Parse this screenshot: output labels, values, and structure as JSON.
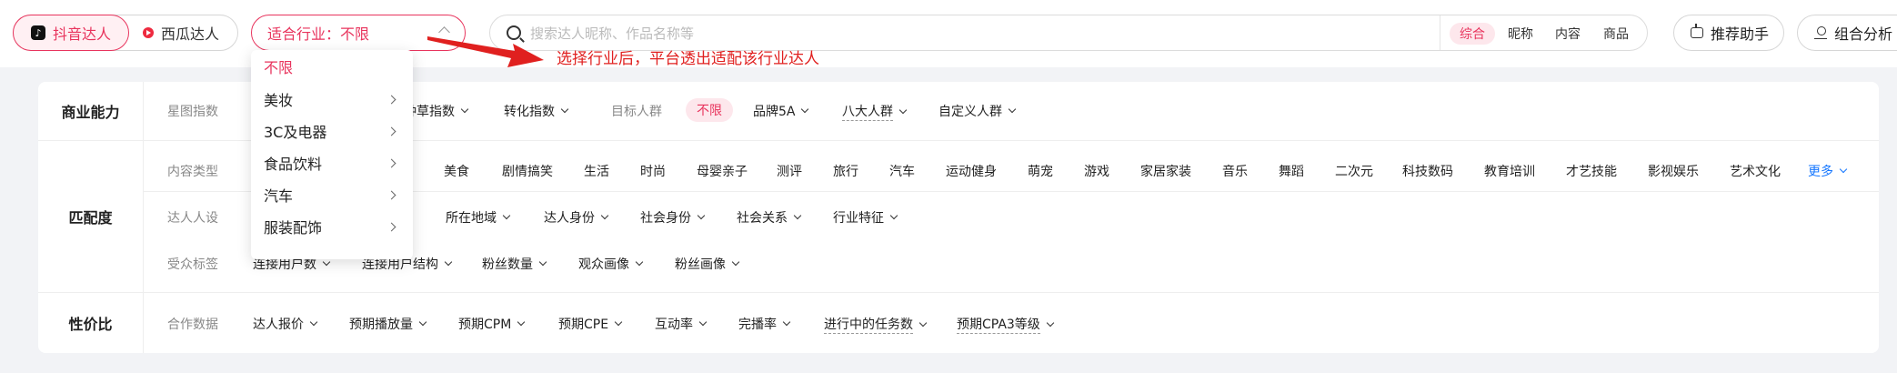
{
  "platform_tabs": {
    "douyin": "抖音达人",
    "xigua": "西瓜达人"
  },
  "industry_select": {
    "value": "适合行业：不限"
  },
  "search": {
    "placeholder": "搜索达人昵称、作品名称等",
    "scopes": [
      "综合",
      "昵称",
      "内容",
      "商品"
    ],
    "active_scope": "综合"
  },
  "actions": {
    "assistant": "推荐助手",
    "analysis": "组合分析"
  },
  "annotation": {
    "text": "选择行业后，平台透出适配该行业达人"
  },
  "industry_dropdown": {
    "items": [
      {
        "label": "不限",
        "selected": true,
        "has_children": false
      },
      {
        "label": "美妆",
        "selected": false,
        "has_children": true
      },
      {
        "label": "3C及电器",
        "selected": false,
        "has_children": true
      },
      {
        "label": "食品饮料",
        "selected": false,
        "has_children": true
      },
      {
        "label": "汽车",
        "selected": false,
        "has_children": true
      },
      {
        "label": "服装配饰",
        "selected": false,
        "has_children": true
      }
    ]
  },
  "filters": {
    "commercial": {
      "title": "商业能力",
      "label": "星图指数",
      "items": [
        "种草指数",
        "转化指数"
      ],
      "target_label": "目标人群",
      "target_selected": "不限",
      "target_items": [
        "品牌5A",
        "八大人群",
        "自定义人群"
      ]
    },
    "match": {
      "title": "匹配度",
      "content_label": "内容类型",
      "content_items": [
        "美食",
        "剧情搞笑",
        "生活",
        "时尚",
        "母婴亲子",
        "测评",
        "旅行",
        "汽车",
        "运动健身",
        "萌宠",
        "游戏",
        "家居家装",
        "音乐",
        "舞蹈",
        "二次元",
        "科技数码",
        "教育培训",
        "才艺技能",
        "影视娱乐",
        "艺术文化"
      ],
      "more": "更多",
      "persona_label": "达人人设",
      "persona_items": [
        "所在地域",
        "达人身份",
        "社会身份",
        "社会关系",
        "行业特征"
      ],
      "audience_label": "受众标签",
      "audience_items": [
        "连接用户数",
        "连接用户结构",
        "粉丝数量",
        "观众画像",
        "粉丝画像"
      ]
    },
    "value": {
      "title": "性价比",
      "label": "合作数据",
      "items": [
        "达人报价",
        "预期播放量",
        "预期CPM",
        "预期CPE",
        "互动率",
        "完播率",
        "进行中的任务数",
        "预期CPA3等级"
      ]
    }
  },
  "colors": {
    "accent": "#e8345d",
    "annotation": "#e0201f",
    "link": "#1677ff"
  }
}
